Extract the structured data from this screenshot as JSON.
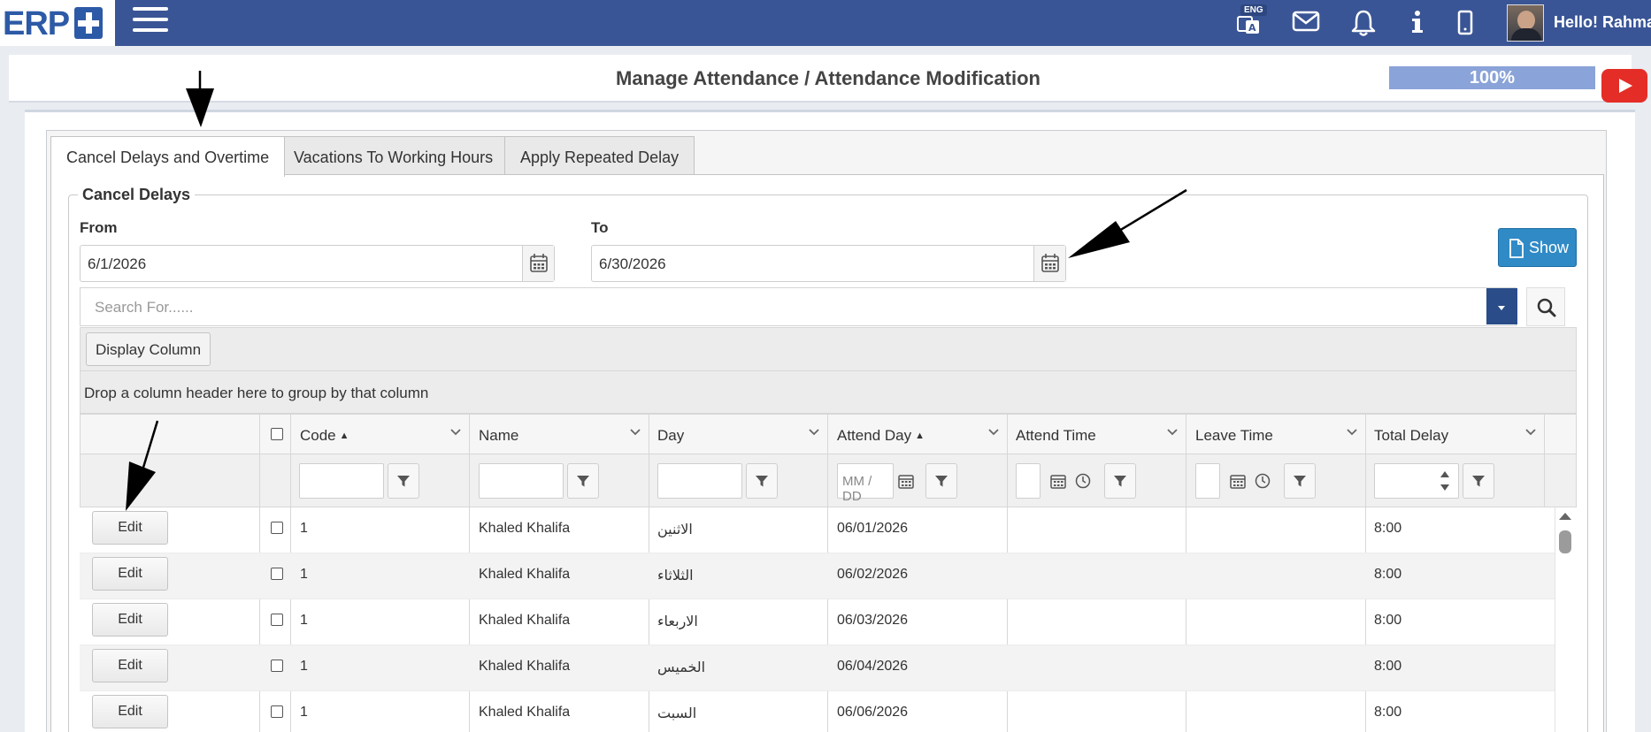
{
  "header": {
    "logo_text": "ERP",
    "lang_badge": "ENG",
    "greeting": "Hello! Rahma",
    "icons": [
      "translate-icon",
      "mail-icon",
      "bell-icon",
      "info-icon",
      "mobile-icon"
    ]
  },
  "title_bar": {
    "title": "Manage Attendance / Attendance Modification",
    "progress_text": "100%",
    "progress_value": 100
  },
  "tabs": [
    {
      "label": "Cancel Delays and Overtime",
      "active": true
    },
    {
      "label": "Vacations To Working Hours",
      "active": false
    },
    {
      "label": "Apply Repeated Delay",
      "active": false
    }
  ],
  "form": {
    "legend": "Cancel Delays",
    "from_label": "From",
    "from_value": "6/1/2026",
    "to_label": "To",
    "to_value": "6/30/2026",
    "show_label": "Show",
    "search_placeholder": "Search For......"
  },
  "grid": {
    "display_column_label": "Display Column",
    "group_hint": "Drop a column header here to group by that column",
    "columns": [
      "Code",
      "Name",
      "Day",
      "Attend Day",
      "Attend Time",
      "Leave Time",
      "Total Delay"
    ],
    "date_filter_placeholder": "MM / DD",
    "edit_label": "Edit",
    "rows": [
      {
        "code": "1",
        "name": "Khaled Khalifa",
        "day": "الاثنين",
        "attend_day": "06/01/2026",
        "attend_time": "",
        "leave_time": "",
        "total_delay": "8:00"
      },
      {
        "code": "1",
        "name": "Khaled Khalifa",
        "day": "الثلاثاء",
        "attend_day": "06/02/2026",
        "attend_time": "",
        "leave_time": "",
        "total_delay": "8:00"
      },
      {
        "code": "1",
        "name": "Khaled Khalifa",
        "day": "الاربعاء",
        "attend_day": "06/03/2026",
        "attend_time": "",
        "leave_time": "",
        "total_delay": "8:00"
      },
      {
        "code": "1",
        "name": "Khaled Khalifa",
        "day": "الخميس",
        "attend_day": "06/04/2026",
        "attend_time": "",
        "leave_time": "",
        "total_delay": "8:00"
      },
      {
        "code": "1",
        "name": "Khaled Khalifa",
        "day": "السبت",
        "attend_day": "06/06/2026",
        "attend_time": "",
        "leave_time": "",
        "total_delay": "8:00"
      }
    ]
  },
  "colors": {
    "topbar": "#3a5595",
    "show_button": "#2f8ac6",
    "progress_fill": "#8aa3d8",
    "youtube": "#e52d27"
  }
}
